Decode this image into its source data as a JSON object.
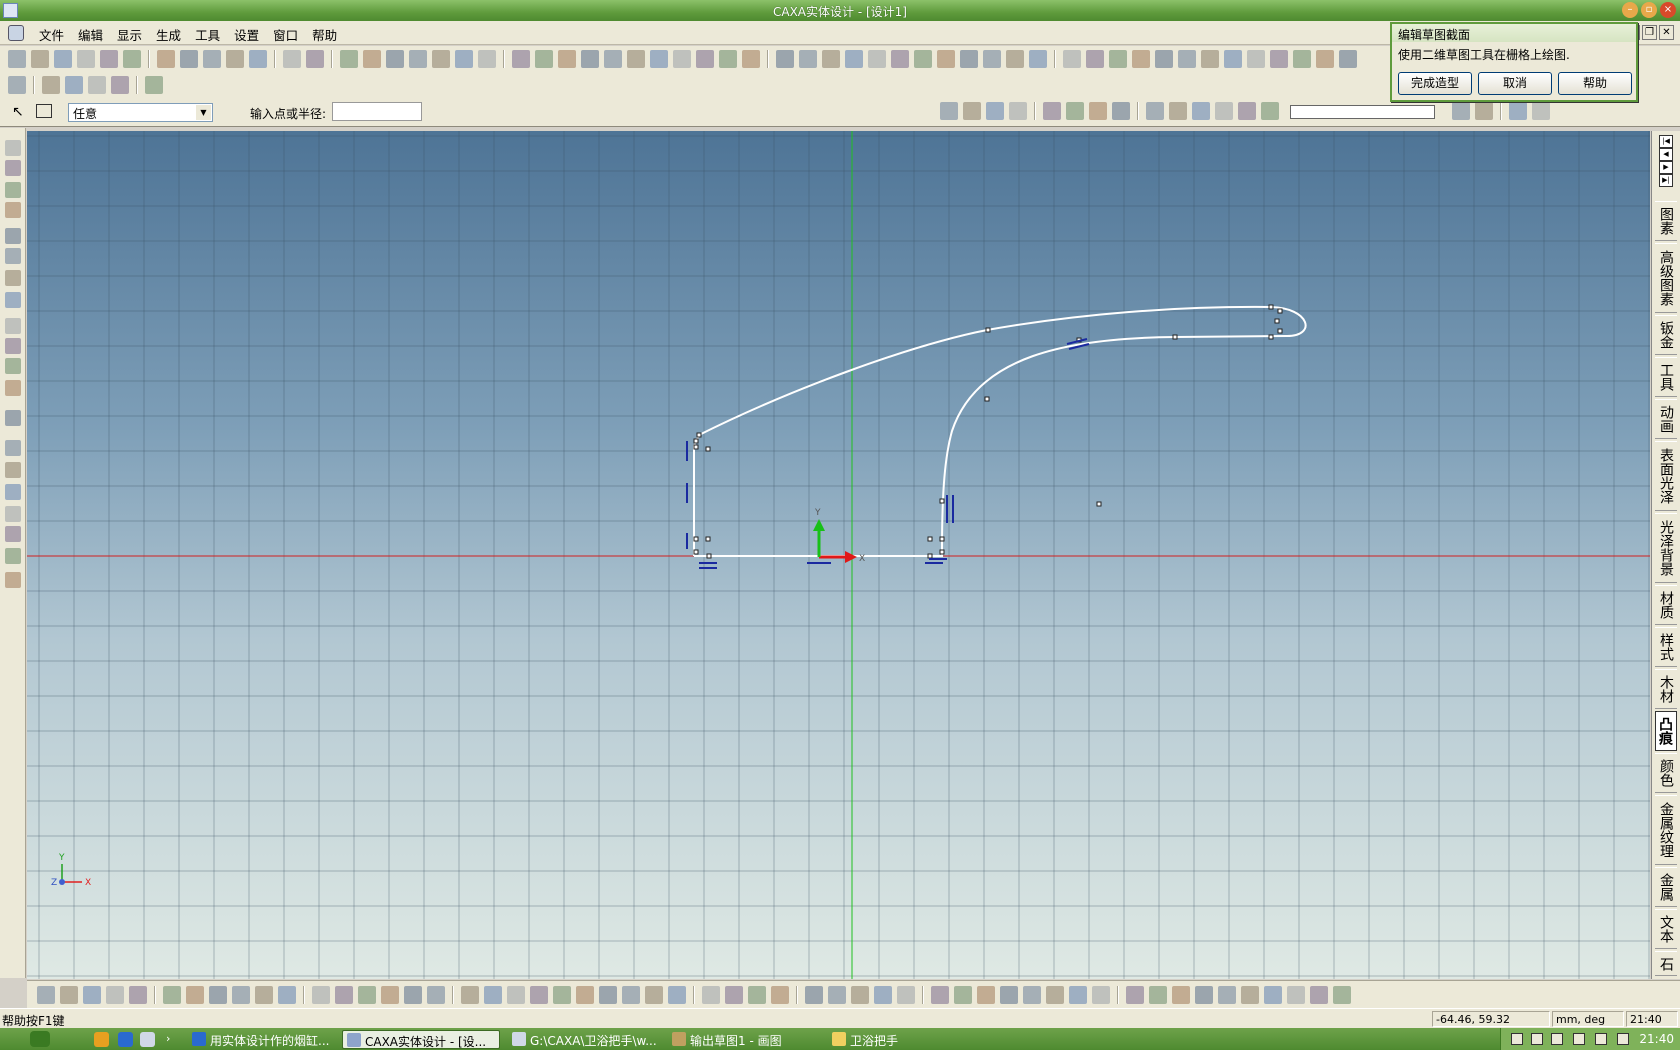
{
  "window": {
    "title": "CAXA实体设计 - [设计1]",
    "min_glyph": "–",
    "max_glyph": "▫",
    "close_glyph": "×"
  },
  "menu": {
    "items": [
      "文件",
      "编辑",
      "显示",
      "生成",
      "工具",
      "设置",
      "窗口",
      "帮助"
    ],
    "mdi_min": "_",
    "mdi_restore": "❐",
    "mdi_close": "✕"
  },
  "sketch_bar": {
    "select_value": "任意",
    "select_arrow": "▼",
    "input_label": "输入点或半径:",
    "input_value": ""
  },
  "dialog": {
    "title": "编辑草图截面",
    "message": "使用二维草图工具在栅格上绘图.",
    "buttons": [
      "完成造型",
      "取消",
      "帮助"
    ]
  },
  "right_tabs": {
    "nav": [
      "|◀",
      "◀",
      "▶",
      "▶|"
    ],
    "tabs": [
      "图素",
      "高级图素",
      "钣金",
      "工具",
      "动画",
      "表面光泽",
      "光泽背景",
      "材质",
      "样式",
      "木材",
      "凸痕",
      "颜色",
      "金属纹理",
      "金属",
      "文本",
      "石"
    ],
    "active": "凸痕"
  },
  "viewport": {
    "axis_x_label": "X",
    "axis_y_label": "Y",
    "triad_x": "X",
    "triad_y": "Y",
    "triad_z": "Z"
  },
  "status": {
    "help": "帮助按F1键",
    "coords": "-64.46, 59.32",
    "units": "mm, deg",
    "time": "21:40"
  },
  "taskbar": {
    "tasks": [
      "用实体设计作的烟缸...",
      "CAXA实体设计 - [设...",
      "G:\\CAXA\\卫浴把手\\w...",
      "输出草图1 - 画图",
      "卫浴把手"
    ],
    "active_task": "CAXA实体设计 - [设...",
    "clock": "21:40"
  },
  "colors": {
    "title_green": "#5f9b3c",
    "viewport_top": "#4e7496",
    "viewport_bottom": "#dfe9e4",
    "x_axis_line": "#d02020",
    "y_axis_line": "#20c020",
    "sketch_curve": "#ffffff",
    "constraint_mark": "#1a2aa0"
  }
}
